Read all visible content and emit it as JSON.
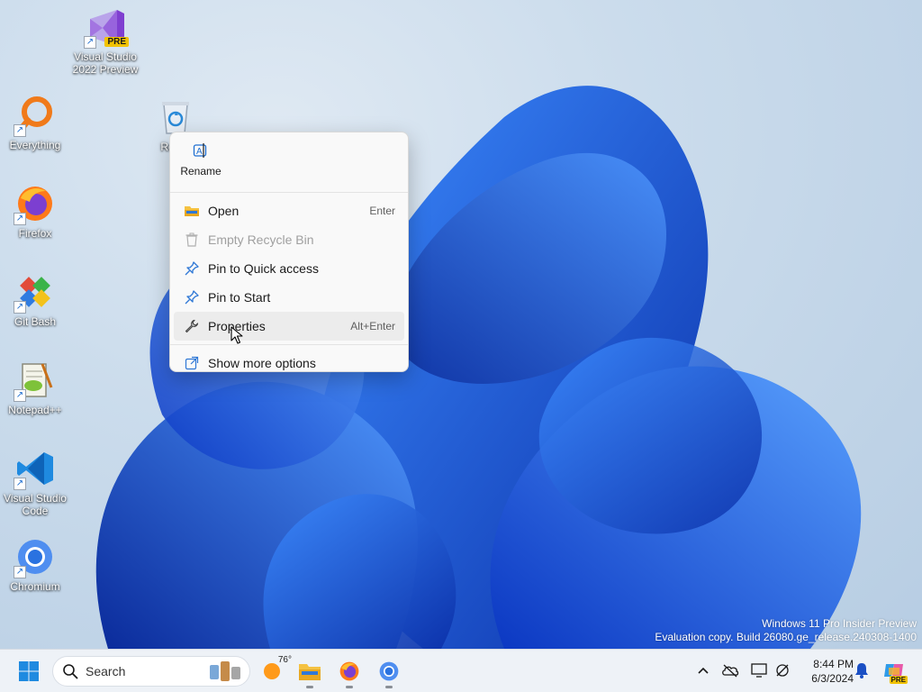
{
  "desktop": {
    "icons": [
      {
        "label": "Visual Studio 2022 Preview",
        "icon": "visual-studio-preview-icon",
        "badge": "PRE"
      },
      {
        "label": "Everything",
        "icon": "everything-search-icon"
      },
      {
        "label": "Recyc",
        "icon": "recycle-bin-icon"
      },
      {
        "label": "Firefox",
        "icon": "firefox-icon"
      },
      {
        "label": "Git Bash",
        "icon": "git-bash-icon"
      },
      {
        "label": "Notepad++",
        "icon": "notepad-plus-plus-icon"
      },
      {
        "label": "Visual Studio Code",
        "icon": "vscode-icon"
      },
      {
        "label": "Chromium",
        "icon": "chromium-icon"
      }
    ],
    "watermark": {
      "line1": "Windows 11 Pro Insider Preview",
      "line2": "Evaluation copy. Build 26080.ge_release.240308-1400"
    }
  },
  "context_menu": {
    "top_actions": [
      {
        "label": "Rename",
        "icon": "rename-icon"
      }
    ],
    "items": [
      {
        "label": "Open",
        "shortcut": "Enter",
        "icon": "folder-open-icon",
        "enabled": true
      },
      {
        "label": "Empty Recycle Bin",
        "shortcut": "",
        "icon": "trash-icon",
        "enabled": false
      },
      {
        "label": "Pin to Quick access",
        "shortcut": "",
        "icon": "pin-icon",
        "enabled": true
      },
      {
        "label": "Pin to Start",
        "shortcut": "",
        "icon": "pin-icon",
        "enabled": true
      },
      {
        "label": "Properties",
        "shortcut": "Alt+Enter",
        "icon": "wrench-icon",
        "enabled": true,
        "hovered": true
      }
    ],
    "more": {
      "label": "Show more options",
      "icon": "external-options-icon"
    }
  },
  "taskbar": {
    "search_label": "Search",
    "weather_temp": "76°",
    "pinned": [
      "start-icon",
      "weather-icon",
      "file-explorer-icon",
      "firefox-icon",
      "chromium-icon"
    ],
    "tray": [
      "chevron-up-icon",
      "onedrive-icon",
      "display-icon",
      "network-icon"
    ],
    "clock": {
      "time": "8:44 PM",
      "date": "6/3/2024"
    },
    "copilot_badge": "PRE"
  },
  "colors": {
    "accent": "#1f6fd1",
    "bloom_dark": "#0a2fa8",
    "bloom_light": "#3d8cff",
    "menu_bg": "#f9f9f9"
  }
}
